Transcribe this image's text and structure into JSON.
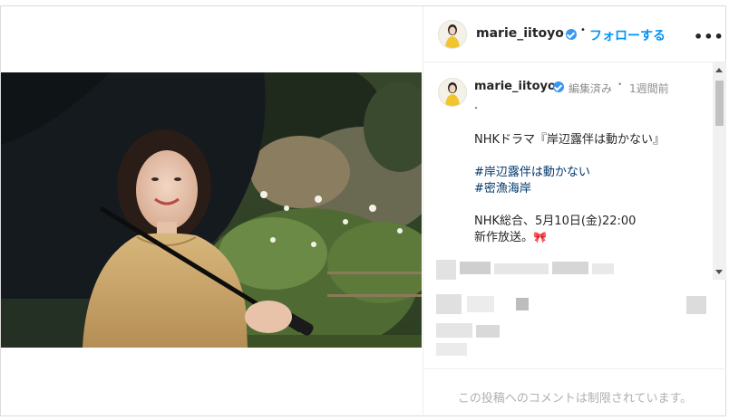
{
  "header": {
    "username": "marie_iitoyo",
    "separator": "•",
    "follow_label": "フォローする",
    "more_label": "•••",
    "avatar_icon": "profile-avatar",
    "verified_icon": "verified-badge-icon"
  },
  "caption": {
    "username": "marie_iitoyo",
    "edited": "編集済み",
    "separator": "•",
    "time": "1週間前",
    "lines": [
      ".",
      "NHKドラマ『岸辺露伴は動かない』",
      "#岸辺露伴は動かない",
      "#密漁海岸",
      "NHK総合、5月10日(金)22:00",
      "新作放送。"
    ],
    "ribbon_icon": "🎀"
  },
  "footer": {
    "comments_disabled": "この投稿へのコメントは制限されています。"
  },
  "colors": {
    "accent": "#0095f6",
    "verified": "#3897f0",
    "hashtag": "#00376b",
    "border": "#dbdbdb"
  }
}
